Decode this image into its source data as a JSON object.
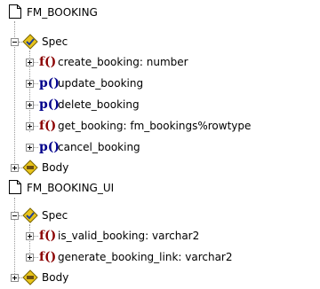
{
  "packages": [
    {
      "name": "FM_BOOKING",
      "spec": {
        "label": "Spec",
        "items": [
          {
            "kind": "f()",
            "label": "create_booking: number"
          },
          {
            "kind": "p()",
            "label": "update_booking"
          },
          {
            "kind": "p()",
            "label": "delete_booking"
          },
          {
            "kind": "f()",
            "label": "get_booking: fm_bookings%rowtype"
          },
          {
            "kind": "p()",
            "label": "cancel_booking"
          }
        ]
      },
      "body": {
        "label": "Body"
      }
    },
    {
      "name": "FM_BOOKING_UI",
      "spec": {
        "label": "Spec",
        "items": [
          {
            "kind": "f()",
            "label": "is_valid_booking: varchar2"
          },
          {
            "kind": "f()",
            "label": "generate_booking_link: varchar2"
          }
        ]
      },
      "body": {
        "label": "Body"
      }
    }
  ],
  "colors": {
    "function_tag": "#8b0000",
    "procedure_tag": "#00008b",
    "spec_icon": "#e8c31a"
  },
  "icons": {
    "package": "package-page-icon",
    "spec": "spec-diamond-icon",
    "body": "body-diamond-icon",
    "expander_open": "minus-box-icon",
    "expander_closed": "plus-box-icon"
  }
}
